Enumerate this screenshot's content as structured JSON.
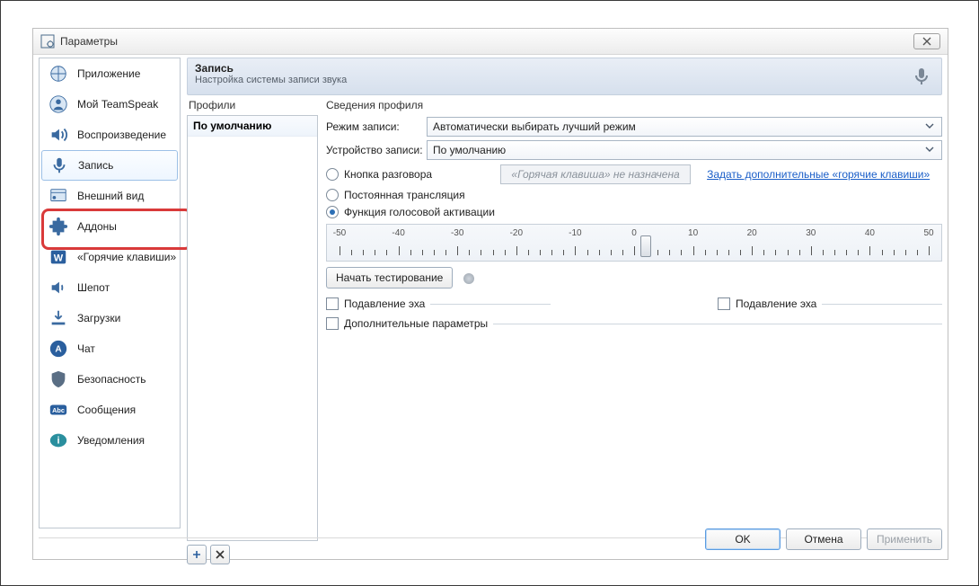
{
  "window": {
    "title": "Параметры"
  },
  "sidebar": {
    "items": [
      {
        "label": "Приложение",
        "icon": "app"
      },
      {
        "label": "Мой TeamSpeak",
        "icon": "user"
      },
      {
        "label": "Воспроизведение",
        "icon": "speaker"
      },
      {
        "label": "Запись",
        "icon": "mic"
      },
      {
        "label": "Внешний вид",
        "icon": "appearance"
      },
      {
        "label": "Аддоны",
        "icon": "puzzle"
      },
      {
        "label": "«Горячие клавиши»",
        "icon": "word"
      },
      {
        "label": "Шепот",
        "icon": "whisper"
      },
      {
        "label": "Загрузки",
        "icon": "download"
      },
      {
        "label": "Чат",
        "icon": "chat"
      },
      {
        "label": "Безопасность",
        "icon": "shield"
      },
      {
        "label": "Сообщения",
        "icon": "abc"
      },
      {
        "label": "Уведомления",
        "icon": "info"
      }
    ],
    "active_index": 3
  },
  "header": {
    "title": "Запись",
    "subtitle": "Настройка системы записи звука"
  },
  "profiles": {
    "label": "Профили",
    "items": [
      "По умолчанию"
    ],
    "add": "＋",
    "del": "✕"
  },
  "details": {
    "section": "Сведения профиля",
    "mode_label": "Режим записи:",
    "mode_value": "Автоматически выбирать лучший режим",
    "device_label": "Устройство записи:",
    "device_value": "По умолчанию",
    "ptt_label": "Кнопка разговора",
    "hotkey_placeholder": "«Горячая клавиша» не назначена",
    "hotkey_link": "Задать дополнительные «горячие клавиши»",
    "cont_label": "Постоянная трансляция",
    "vad_label": "Функция голосовой активации",
    "selected_mode": "vad",
    "ruler": {
      "min": -50,
      "max": 50,
      "step": 10,
      "value": 2
    },
    "test_label": "Начать тестирование",
    "echo1": "Подавление эха",
    "echo2": "Подавление эха",
    "advanced": "Дополнительные параметры"
  },
  "buttons": {
    "ok": "OK",
    "cancel": "Отмена",
    "apply": "Применить"
  }
}
